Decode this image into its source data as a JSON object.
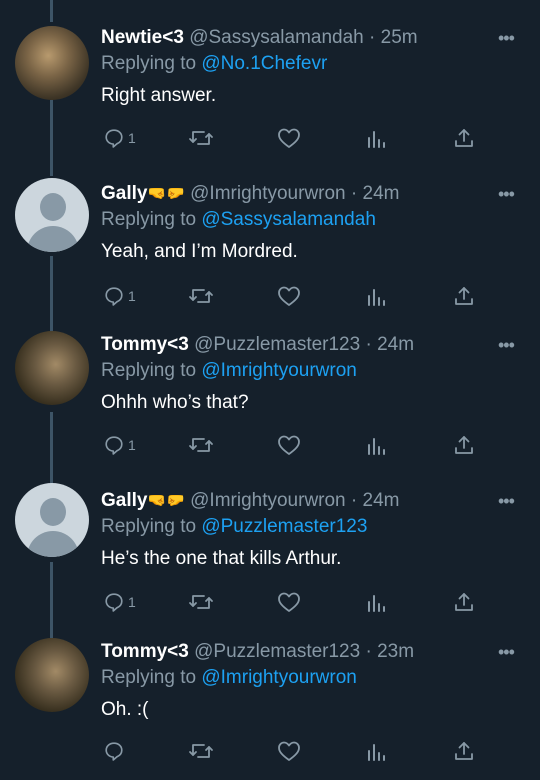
{
  "tweets": [
    {
      "name": "Newtie<3",
      "name_emoji": "",
      "handle": "@Sassysalamandah",
      "time": "25m",
      "replying_label": "Replying to",
      "replying_to": "@No.1Chefevr",
      "text": "Right answer.",
      "reply_count": "1",
      "avatar": "photo"
    },
    {
      "name": "Gally",
      "name_emoji": "🤜🤛",
      "handle": "@Imrightyourwron",
      "time": "24m",
      "replying_label": "Replying to",
      "replying_to": "@Sassysalamandah",
      "text": "Yeah, and I’m Mordred.",
      "reply_count": "1",
      "avatar": "default-profile"
    },
    {
      "name": "Tommy<3",
      "name_emoji": "",
      "handle": "@Puzzlemaster123",
      "time": "24m",
      "replying_label": "Replying to",
      "replying_to": "@Imrightyourwron",
      "text": "Ohhh who’s that?",
      "reply_count": "1",
      "avatar": "photo"
    },
    {
      "name": "Gally",
      "name_emoji": "🤜🤛",
      "handle": "@Imrightyourwron",
      "time": "24m",
      "replying_label": "Replying to",
      "replying_to": "@Puzzlemaster123",
      "text": "He’s the one that kills Arthur.",
      "reply_count": "1",
      "avatar": "default-profile"
    },
    {
      "name": "Tommy<3",
      "name_emoji": "",
      "handle": "@Puzzlemaster123",
      "time": "23m",
      "replying_label": "Replying to",
      "replying_to": "@Imrightyourwron",
      "text": "Oh. :(",
      "reply_count": "",
      "avatar": "photo"
    }
  ],
  "separator": "·",
  "more_glyph": "•••",
  "icons": [
    "reply-icon",
    "retweet-icon",
    "like-icon",
    "analytics-icon",
    "share-icon",
    "more-icon"
  ],
  "colors": {
    "background": "#15202b",
    "text": "#ffffff",
    "muted": "#8899a6",
    "link": "#1da1f2",
    "thread_line": "#3d5466"
  }
}
